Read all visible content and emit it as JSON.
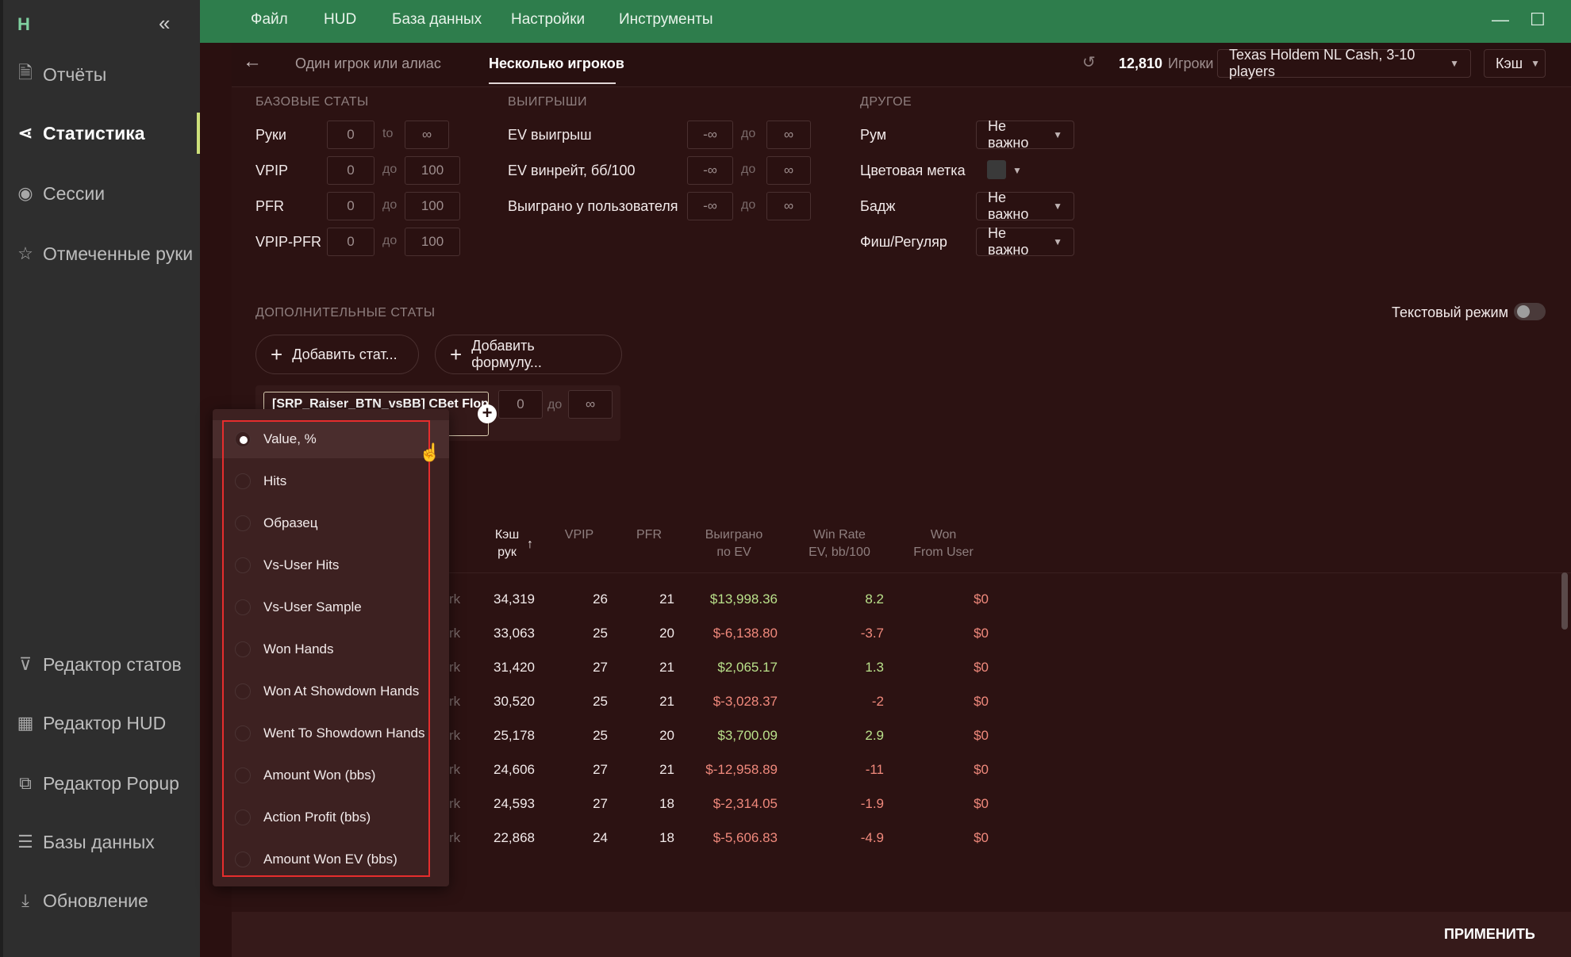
{
  "sidebar": {
    "logo": "H",
    "collapse": "«",
    "items": [
      {
        "label": "Отчёты",
        "icon": "report-icon"
      },
      {
        "label": "Статистика",
        "icon": "share-icon",
        "active": true
      },
      {
        "label": "Сессии",
        "icon": "broadcast-icon"
      },
      {
        "label": "Отмеченные руки",
        "icon": "star-list-icon"
      },
      {
        "label": "Редактор статов",
        "icon": "filter-icon"
      },
      {
        "label": "Редактор HUD",
        "icon": "layout-icon"
      },
      {
        "label": "Редактор Popup",
        "icon": "popup-icon"
      },
      {
        "label": "Базы данных",
        "icon": "database-icon"
      },
      {
        "label": "Обновление",
        "icon": "download-icon"
      }
    ]
  },
  "menu": [
    "Файл",
    "HUD",
    "База данных",
    "Настройки",
    "Инструменты"
  ],
  "tabs": {
    "single": "Один игрок или алиас",
    "multi": "Несколько игроков"
  },
  "header": {
    "count": "12,810",
    "count_label": "Игроки",
    "game": "Texas Holdem NL Cash, 3-10 players",
    "mode": "Кэш"
  },
  "basic": {
    "title": "БАЗОВЫЕ СТАТЫ",
    "rows": [
      {
        "label": "Руки",
        "min": "0",
        "sep": "to",
        "max": "∞"
      },
      {
        "label": "VPIP",
        "min": "0",
        "sep": "до",
        "max": "100"
      },
      {
        "label": "PFR",
        "min": "0",
        "sep": "до",
        "max": "100"
      },
      {
        "label": "VPIP-PFR",
        "min": "0",
        "sep": "до",
        "max": "100"
      }
    ]
  },
  "winnings": {
    "title": "ВЫИГРЫШИ",
    "rows": [
      {
        "label": "EV выигрыш",
        "min": "-∞",
        "sep": "до",
        "max": "∞"
      },
      {
        "label": "EV винрейт, бб/100",
        "min": "-∞",
        "sep": "до",
        "max": "∞"
      },
      {
        "label": "Выиграно у пользователя",
        "min": "-∞",
        "sep": "до",
        "max": "∞"
      }
    ]
  },
  "other": {
    "title": "ДРУГОЕ",
    "room_label": "Рум",
    "room_value": "Не важно",
    "color_label": "Цветовая метка",
    "badge_label": "Бадж",
    "badge_value": "Не важно",
    "fish_label": "Фиш/Регуляр",
    "fish_value": "Не важно"
  },
  "extra": {
    "title": "ДОПОЛНИТЕЛЬНЫЕ СТАТЫ",
    "text_mode": "Текстовый режим",
    "add_stat": "Добавить стат...",
    "add_formula": "Добавить формулу...",
    "stat_name": "[SRP_Raiser_BTN_vsBB] CBet Flop",
    "stat_min": "0",
    "stat_sep": "до",
    "stat_max": "∞"
  },
  "table": {
    "headers": {
      "hands_1": "Кэш",
      "hands_2": "рук",
      "sort": "↑",
      "vpip": "VPIP",
      "pfr": "PFR",
      "won_ev_1": "Выиграно",
      "won_ev_2": "по EV",
      "wr_1": "Win Rate",
      "wr_2": "EV, bb/100",
      "wfu_1": "Won",
      "wfu_2": "From User"
    },
    "rows": [
      {
        "name": "rk",
        "hands": "34,319",
        "vpip": "26",
        "pfr": "21",
        "won": "$13,998.36",
        "wr": "8.2",
        "wfu": "$0"
      },
      {
        "name": "rk",
        "hands": "33,063",
        "vpip": "25",
        "pfr": "20",
        "won": "$-6,138.80",
        "wr": "-3.7",
        "wfu": "$0"
      },
      {
        "name": "rk",
        "hands": "31,420",
        "vpip": "27",
        "pfr": "21",
        "won": "$2,065.17",
        "wr": "1.3",
        "wfu": "$0"
      },
      {
        "name": "rk",
        "hands": "30,520",
        "vpip": "25",
        "pfr": "21",
        "won": "$-3,028.37",
        "wr": "-2",
        "wfu": "$0"
      },
      {
        "name": "rk",
        "hands": "25,178",
        "vpip": "25",
        "pfr": "20",
        "won": "$3,700.09",
        "wr": "2.9",
        "wfu": "$0"
      },
      {
        "name": "rk",
        "hands": "24,606",
        "vpip": "27",
        "pfr": "21",
        "won": "$-12,958.89",
        "wr": "-11",
        "wfu": "$0"
      },
      {
        "name": "rk",
        "hands": "24,593",
        "vpip": "27",
        "pfr": "18",
        "won": "$-2,314.05",
        "wr": "-1.9",
        "wfu": "$0"
      },
      {
        "name": "rk",
        "hands": "22,868",
        "vpip": "24",
        "pfr": "18",
        "won": "$-5,606.83",
        "wr": "-4.9",
        "wfu": "$0"
      }
    ]
  },
  "popup": {
    "options": [
      {
        "label": "Value, %",
        "selected": true
      },
      {
        "label": "Hits"
      },
      {
        "label": "Образец"
      },
      {
        "label": "Vs-User Hits"
      },
      {
        "label": "Vs-User Sample"
      },
      {
        "label": "Won Hands"
      },
      {
        "label": "Won At Showdown Hands"
      },
      {
        "label": "Went To Showdown Hands"
      },
      {
        "label": "Amount Won (bbs)"
      },
      {
        "label": "Action Profit (bbs)"
      },
      {
        "label": "Amount Won EV (bbs)"
      }
    ]
  },
  "footer": {
    "apply": "ПРИМЕНИТЬ"
  },
  "colors": {
    "topbar": "#2e7d4c",
    "panel": "#2c1212",
    "positive": "#b9e08a",
    "negative": "#f0897c",
    "highlight": "#e52d2d"
  }
}
